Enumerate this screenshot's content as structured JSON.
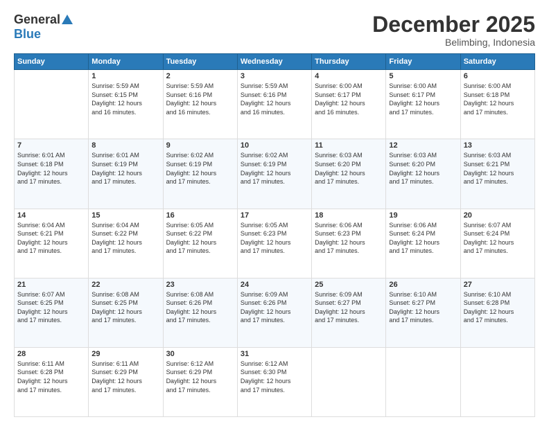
{
  "logo": {
    "general": "General",
    "blue": "Blue"
  },
  "header": {
    "month": "December 2025",
    "location": "Belimbing, Indonesia"
  },
  "days_of_week": [
    "Sunday",
    "Monday",
    "Tuesday",
    "Wednesday",
    "Thursday",
    "Friday",
    "Saturday"
  ],
  "weeks": [
    [
      {
        "day": "",
        "sunrise": "",
        "sunset": "",
        "daylight": ""
      },
      {
        "day": "1",
        "sunrise": "5:59 AM",
        "sunset": "6:15 PM",
        "daylight": "12 hours and 16 minutes."
      },
      {
        "day": "2",
        "sunrise": "5:59 AM",
        "sunset": "6:16 PM",
        "daylight": "12 hours and 16 minutes."
      },
      {
        "day": "3",
        "sunrise": "5:59 AM",
        "sunset": "6:16 PM",
        "daylight": "12 hours and 16 minutes."
      },
      {
        "day": "4",
        "sunrise": "6:00 AM",
        "sunset": "6:17 PM",
        "daylight": "12 hours and 16 minutes."
      },
      {
        "day": "5",
        "sunrise": "6:00 AM",
        "sunset": "6:17 PM",
        "daylight": "12 hours and 17 minutes."
      },
      {
        "day": "6",
        "sunrise": "6:00 AM",
        "sunset": "6:18 PM",
        "daylight": "12 hours and 17 minutes."
      }
    ],
    [
      {
        "day": "7",
        "sunrise": "6:01 AM",
        "sunset": "6:18 PM",
        "daylight": "12 hours and 17 minutes."
      },
      {
        "day": "8",
        "sunrise": "6:01 AM",
        "sunset": "6:19 PM",
        "daylight": "12 hours and 17 minutes."
      },
      {
        "day": "9",
        "sunrise": "6:02 AM",
        "sunset": "6:19 PM",
        "daylight": "12 hours and 17 minutes."
      },
      {
        "day": "10",
        "sunrise": "6:02 AM",
        "sunset": "6:19 PM",
        "daylight": "12 hours and 17 minutes."
      },
      {
        "day": "11",
        "sunrise": "6:03 AM",
        "sunset": "6:20 PM",
        "daylight": "12 hours and 17 minutes."
      },
      {
        "day": "12",
        "sunrise": "6:03 AM",
        "sunset": "6:20 PM",
        "daylight": "12 hours and 17 minutes."
      },
      {
        "day": "13",
        "sunrise": "6:03 AM",
        "sunset": "6:21 PM",
        "daylight": "12 hours and 17 minutes."
      }
    ],
    [
      {
        "day": "14",
        "sunrise": "6:04 AM",
        "sunset": "6:21 PM",
        "daylight": "12 hours and 17 minutes."
      },
      {
        "day": "15",
        "sunrise": "6:04 AM",
        "sunset": "6:22 PM",
        "daylight": "12 hours and 17 minutes."
      },
      {
        "day": "16",
        "sunrise": "6:05 AM",
        "sunset": "6:22 PM",
        "daylight": "12 hours and 17 minutes."
      },
      {
        "day": "17",
        "sunrise": "6:05 AM",
        "sunset": "6:23 PM",
        "daylight": "12 hours and 17 minutes."
      },
      {
        "day": "18",
        "sunrise": "6:06 AM",
        "sunset": "6:23 PM",
        "daylight": "12 hours and 17 minutes."
      },
      {
        "day": "19",
        "sunrise": "6:06 AM",
        "sunset": "6:24 PM",
        "daylight": "12 hours and 17 minutes."
      },
      {
        "day": "20",
        "sunrise": "6:07 AM",
        "sunset": "6:24 PM",
        "daylight": "12 hours and 17 minutes."
      }
    ],
    [
      {
        "day": "21",
        "sunrise": "6:07 AM",
        "sunset": "6:25 PM",
        "daylight": "12 hours and 17 minutes."
      },
      {
        "day": "22",
        "sunrise": "6:08 AM",
        "sunset": "6:25 PM",
        "daylight": "12 hours and 17 minutes."
      },
      {
        "day": "23",
        "sunrise": "6:08 AM",
        "sunset": "6:26 PM",
        "daylight": "12 hours and 17 minutes."
      },
      {
        "day": "24",
        "sunrise": "6:09 AM",
        "sunset": "6:26 PM",
        "daylight": "12 hours and 17 minutes."
      },
      {
        "day": "25",
        "sunrise": "6:09 AM",
        "sunset": "6:27 PM",
        "daylight": "12 hours and 17 minutes."
      },
      {
        "day": "26",
        "sunrise": "6:10 AM",
        "sunset": "6:27 PM",
        "daylight": "12 hours and 17 minutes."
      },
      {
        "day": "27",
        "sunrise": "6:10 AM",
        "sunset": "6:28 PM",
        "daylight": "12 hours and 17 minutes."
      }
    ],
    [
      {
        "day": "28",
        "sunrise": "6:11 AM",
        "sunset": "6:28 PM",
        "daylight": "12 hours and 17 minutes."
      },
      {
        "day": "29",
        "sunrise": "6:11 AM",
        "sunset": "6:29 PM",
        "daylight": "12 hours and 17 minutes."
      },
      {
        "day": "30",
        "sunrise": "6:12 AM",
        "sunset": "6:29 PM",
        "daylight": "12 hours and 17 minutes."
      },
      {
        "day": "31",
        "sunrise": "6:12 AM",
        "sunset": "6:30 PM",
        "daylight": "12 hours and 17 minutes."
      },
      {
        "day": "",
        "sunrise": "",
        "sunset": "",
        "daylight": ""
      },
      {
        "day": "",
        "sunrise": "",
        "sunset": "",
        "daylight": ""
      },
      {
        "day": "",
        "sunrise": "",
        "sunset": "",
        "daylight": ""
      }
    ]
  ],
  "labels": {
    "sunrise": "Sunrise:",
    "sunset": "Sunset:",
    "daylight": "Daylight:"
  }
}
